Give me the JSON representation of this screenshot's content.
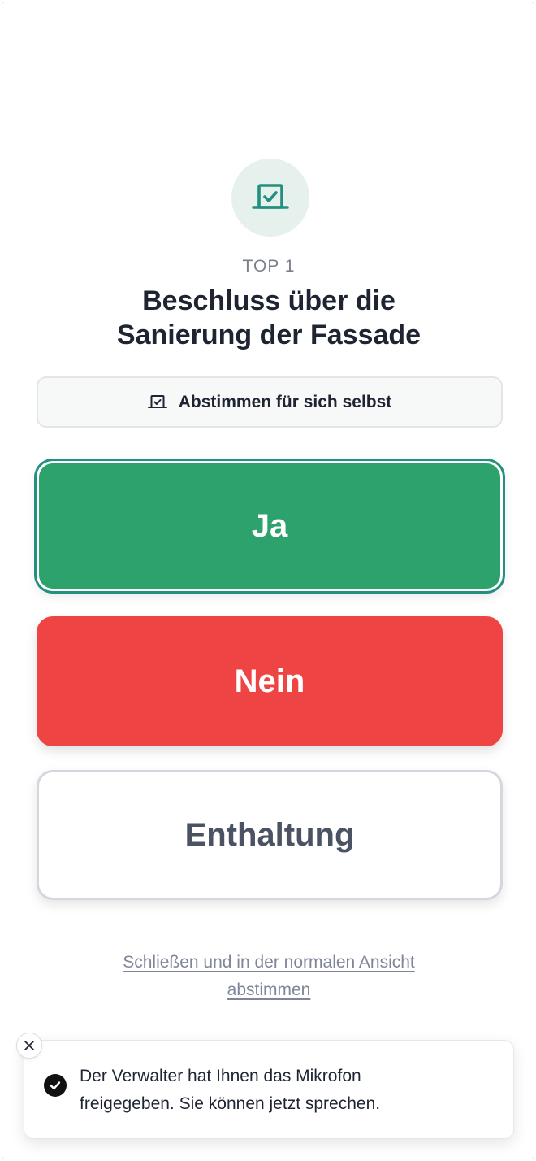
{
  "agenda": {
    "icon": "ballot-box-icon",
    "top_label": "TOP 1",
    "title_line1": "Beschluss über die",
    "title_line2": "Sanierung der Fassade"
  },
  "self_vote": {
    "icon": "ballot-box-icon",
    "label": "Abstimmen für sich selbst"
  },
  "options": {
    "yes": "Ja",
    "no": "Nein",
    "abstain": "Enthaltung"
  },
  "close_link": {
    "line1": "Schließen und in der normalen Ansicht",
    "line2": "abstimmen"
  },
  "toast": {
    "icon": "check-circle-icon",
    "close_icon": "close-icon",
    "line1": "Der Verwalter hat Ihnen das Mikrofon",
    "line2": "freigegeben. Sie können jetzt sprechen."
  },
  "colors": {
    "accent": "#23907f",
    "yes": "#2ea26d",
    "no": "#ef4444",
    "abstain_text": "#4a5263"
  }
}
